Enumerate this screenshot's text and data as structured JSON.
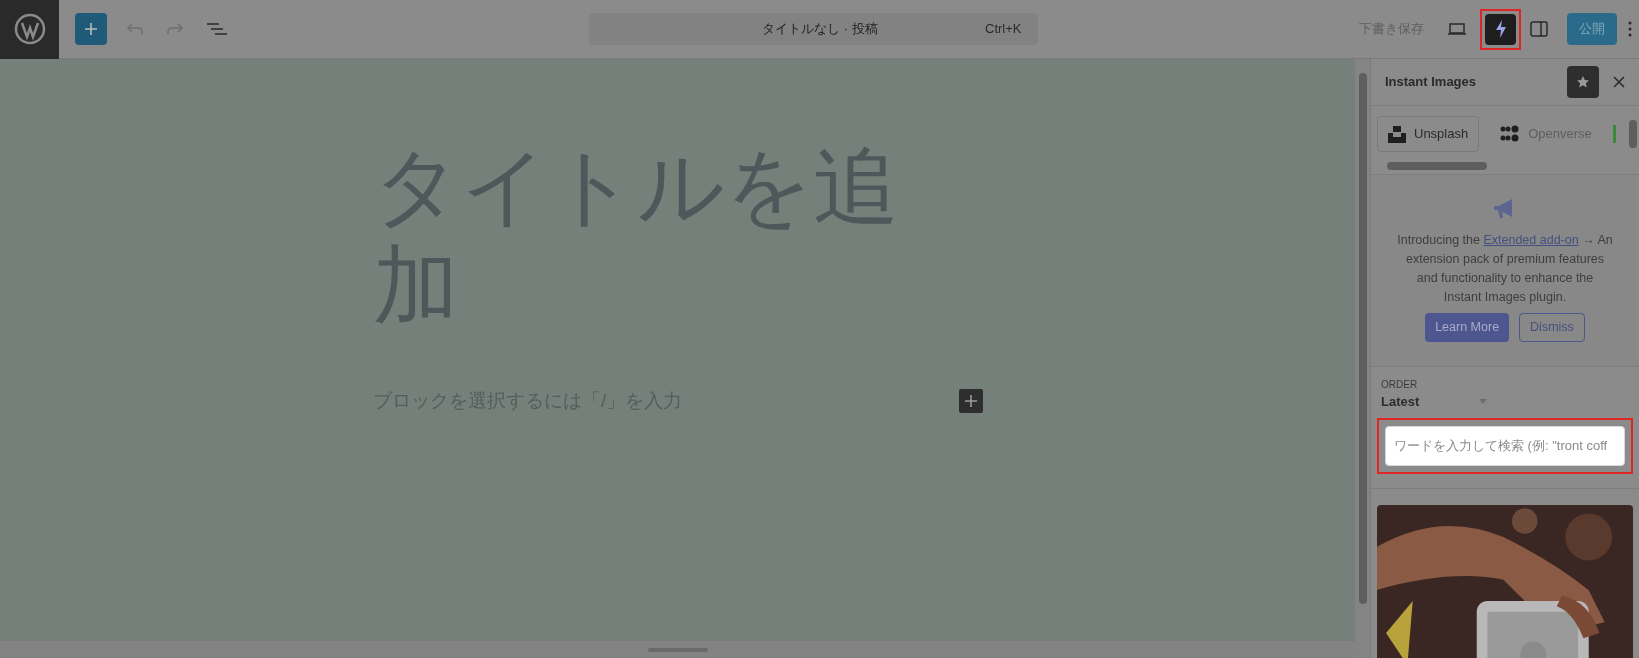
{
  "toolbar": {
    "add_block_selected": true,
    "command_bar": {
      "title": "タイトルなし · 投稿",
      "shortcut": "Ctrl+K"
    },
    "save_draft": "下書き保存",
    "instant_images": {
      "selected": true,
      "highlight": true
    },
    "publish": "公開"
  },
  "editor": {
    "title_placeholder": "タイトルを追加",
    "block_placeholder": "ブロックを選択するには「/」を入力"
  },
  "sidebar": {
    "title": "Instant Images",
    "sources": [
      {
        "label": "Unsplash",
        "selected": true
      },
      {
        "label": "Openverse",
        "selected": false
      }
    ],
    "notice": {
      "intro": "Introducing the",
      "link": "Extended add-on",
      "text": "→ An extension pack of premium features and functionality to enhance the Instant Images plugin.",
      "buttons": [
        "Learn More",
        "Dismiss"
      ]
    },
    "order": {
      "label": "ORDER",
      "value": "Latest"
    },
    "search": {
      "placeholder": "ワードを入力して検索 (例: \"tront coff",
      "highlight": true
    }
  }
}
